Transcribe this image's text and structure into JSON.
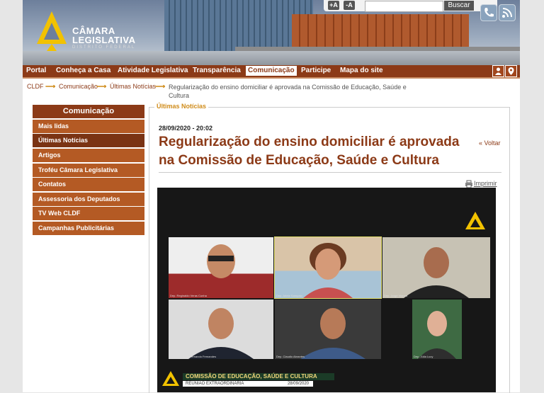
{
  "header": {
    "logo_line1": "CÂMARA",
    "logo_line2": "LEGISLATIVA",
    "logo_line3": "DISTRITO FEDERAL",
    "font_increase": "+A",
    "font_decrease": "-A",
    "search_placeholder": "",
    "search_button": "Buscar"
  },
  "nav": {
    "items": [
      "Portal",
      "Conheça a Casa",
      "Atividade Legislativa",
      "Transparência",
      "Comunicação",
      "Participe",
      "Mapa do site"
    ],
    "active": "Comunicação"
  },
  "breadcrumb": {
    "items": [
      "CLDF",
      "Comunicação",
      "Últimas Notícias"
    ],
    "current": "Regularização do ensino domiciliar é aprovada na Comissão de Educação, Saúde e Cultura"
  },
  "sidebar": {
    "title": "Comunicação",
    "items": [
      "Mais lidas",
      "Últimas Notícias",
      "Artigos",
      "Troféu Câmara Legislativa",
      "Contatos",
      "Assessoria dos Deputados",
      "TV Web CLDF",
      "Campanhas Publicitárias"
    ],
    "selected": "Últimas Notícias"
  },
  "article": {
    "section": "Últimas Notícias",
    "date": "28/09/2020 - 20:02",
    "title": "Regularização do ensino domiciliar é aprovada na Comissão de Educação, Saúde e Cultura",
    "back": "« Voltar",
    "print": "Imprimir"
  },
  "video": {
    "participants": [
      "Dep. Reginaldo Veras Cunha",
      "Dep. Arlete Sampaio",
      "Dep. Jorge Vianna",
      "Dep. Delegado Fernando Fernandes",
      "Dep. Claudio Abrantes",
      "Dep. Júlia Lucy"
    ],
    "banner_title": "COMISSÃO DE EDUCAÇÃO, SAÚDE E CULTURA",
    "banner_sub": "REUNIÃO EXTRAORDINÁRIA",
    "banner_date": "28/09/2020"
  },
  "colors": {
    "brand": "#8c3a17",
    "accent": "#d08c1a"
  }
}
